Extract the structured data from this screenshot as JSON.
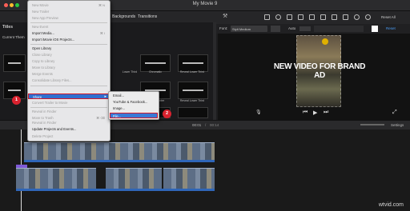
{
  "window": {
    "title": "My Movie 9",
    "reset_all": "Reset All"
  },
  "toolbar": {
    "backgrounds": "Backgrounds",
    "transitions": "Transitions",
    "titles": "Titles",
    "current_theme": "Current Them"
  },
  "viewer_tools": {
    "font_label": "Font:",
    "font_value": "Stylt Medium",
    "auto": "Auto",
    "reset": "Reset",
    "done": "▾"
  },
  "titles_grid": [
    {
      "caption": "Lower Third"
    },
    {
      "caption": "Chromatic"
    },
    {
      "caption": "Reveal Lower Third"
    },
    {
      "caption": "Reveal Center"
    },
    {
      "caption": "Reveal Lower Third"
    },
    {
      "caption": "Reveal Center"
    }
  ],
  "file_menu": [
    {
      "label": "New Movie",
      "shortcut": "⌘ N",
      "disabled": true
    },
    {
      "label": "New Trailer",
      "shortcut": "",
      "disabled": true
    },
    {
      "label": "New App Preview",
      "shortcut": "",
      "disabled": true
    },
    {
      "label": "New Event",
      "shortcut": "",
      "disabled": true
    },
    {
      "label": "Import Media...",
      "shortcut": "⌘ I",
      "disabled": false
    },
    {
      "label": "Import iMovie iOS Projects...",
      "shortcut": "",
      "disabled": false
    },
    {
      "label": "Open Library",
      "shortcut": "",
      "disabled": false
    },
    {
      "label": "Close Library",
      "shortcut": "",
      "disabled": true
    },
    {
      "label": "Copy to Library",
      "shortcut": "",
      "disabled": true
    },
    {
      "label": "Move to Library",
      "shortcut": "",
      "disabled": true
    },
    {
      "label": "Merge Events",
      "shortcut": "",
      "disabled": true
    },
    {
      "label": "Consolidate Library Files...",
      "shortcut": "",
      "disabled": true
    },
    {
      "label": "Share",
      "shortcut": "",
      "disabled": false
    },
    {
      "label": "Convert Trailer to Movie",
      "shortcut": "",
      "disabled": true
    },
    {
      "label": "Reveal in Finder",
      "shortcut": "",
      "disabled": true
    },
    {
      "label": "Move to Trash",
      "shortcut": "⌘ ⌫",
      "disabled": true
    },
    {
      "label": "Reveal in Project Media",
      "shortcut": "",
      "disabled": true
    },
    {
      "label": "Reveal in Finder",
      "shortcut": "",
      "disabled": true
    },
    {
      "label": "Update Projects and Events...",
      "shortcut": "",
      "disabled": false
    },
    {
      "label": "Delete Project",
      "shortcut": "",
      "disabled": true
    }
  ],
  "share_menu": [
    {
      "label": "Email..."
    },
    {
      "label": "YouTube & Facebook..."
    },
    {
      "label": "Image..."
    },
    {
      "label": "File..."
    }
  ],
  "badges": {
    "one": "1",
    "two": "2"
  },
  "viewer": {
    "overlay_text": "NEW VIDEO FOR BRAND AD",
    "timecode": "00:01",
    "duration": "00:14"
  },
  "timeline": {
    "settings": "Settings"
  },
  "watermark": "wtvid.com",
  "colors": {
    "highlight": "#2f6fd0",
    "badge": "#d9222f",
    "audio": "#2f66b8"
  }
}
